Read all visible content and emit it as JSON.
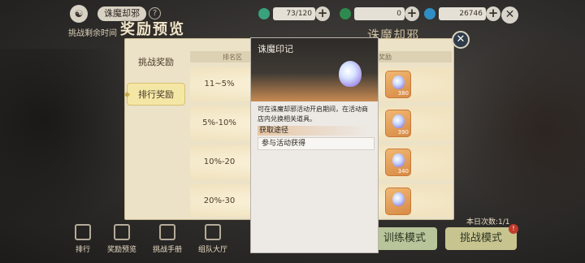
{
  "topbar": {
    "event_name": "诛魔却邪",
    "help": "?",
    "remaining_time_label": "挑战剩余时间",
    "resources": [
      {
        "icon": "jade-coin-icon",
        "color": "#3aa17e",
        "value": "73/120"
      },
      {
        "icon": "green-orb-icon",
        "color": "#2e8a4e",
        "value": "0"
      },
      {
        "icon": "blue-gem-icon",
        "color": "#2f8fc4",
        "value": "26746"
      }
    ],
    "plus": "+",
    "close": "✕"
  },
  "background": {
    "title_right": "诛魔却邪",
    "today_count": "本日次数:1/1",
    "train_mode": "训练模式",
    "challenge_mode": "挑战模式",
    "challenge_badge": "!",
    "nav": [
      {
        "label": "排行",
        "icon": "ranking-icon"
      },
      {
        "label": "奖励预览",
        "icon": "reward-preview-icon"
      },
      {
        "label": "挑战手册",
        "icon": "handbook-icon"
      },
      {
        "label": "组队大厅",
        "icon": "team-hall-icon"
      }
    ]
  },
  "reward_panel": {
    "title": "奖励预览",
    "close": "✕",
    "tabs": {
      "challenge": "挑战奖励",
      "rank": "排行奖励"
    },
    "headers": {
      "rank": "排名区",
      "reward": "奖励"
    },
    "rows": [
      {
        "range": "11~5%",
        "qty": "380"
      },
      {
        "range": "5%-10%",
        "qty": "390"
      },
      {
        "range": "10%-20",
        "qty": "340"
      },
      {
        "range": "20%-30",
        "qty": ""
      }
    ]
  },
  "tooltip": {
    "name": "诛魔印记",
    "icon": "demon-seal-icon",
    "description": "可在诛魔却邪活动开启期间，在活动商店内兑换相关道具。",
    "source_label": "获取途径",
    "source": "参与活动获得"
  }
}
